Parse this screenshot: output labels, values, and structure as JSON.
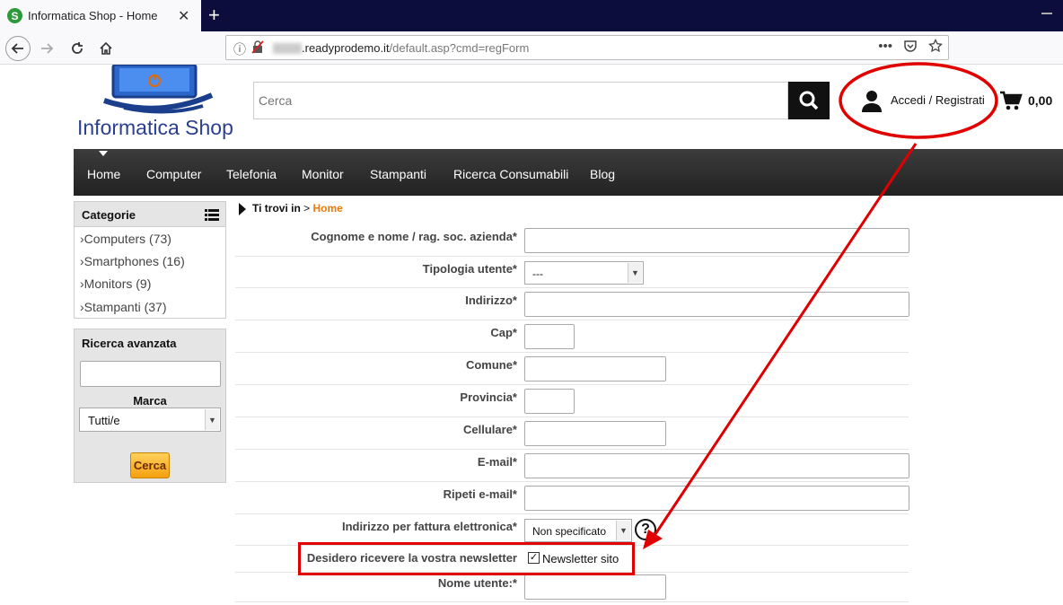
{
  "browser": {
    "tab_title": "Informatica Shop - Home",
    "tab_favicon": "S",
    "close_glyph": "✕",
    "new_tab_glyph": "+",
    "url_domain": ".readyprodemo.it",
    "url_path": "/default.asp?cmd=regForm",
    "icons": [
      "back-icon",
      "forward-icon",
      "reload-icon",
      "home-icon",
      "info-icon",
      "lock-icon",
      "more-icon",
      "pocket-icon",
      "bookmark-star-icon"
    ]
  },
  "header": {
    "logo_text": "Informatica Shop",
    "search_placeholder": "Cerca",
    "login_label": "Accedi / Registrati",
    "cart_total": "0,00"
  },
  "menu": {
    "items": [
      "Home",
      "Computer",
      "Telefonia",
      "Monitor",
      "Stampanti",
      "Ricerca Consumabili",
      "Blog"
    ]
  },
  "sidebar": {
    "categories_title": "Categorie",
    "categories": [
      "Computers (73)",
      "Smartphones (16)",
      "Monitors (9)",
      "Stampanti (37)"
    ],
    "advanced_title": "Ricerca avanzata",
    "brand_label": "Marca",
    "brand_value": "Tutti/e",
    "search_button": "Cerca"
  },
  "breadcrumb": {
    "prefix": "Ti trovi in",
    "separator": ">",
    "current": "Home"
  },
  "form": {
    "fields": [
      {
        "label": "Cognome e nome / rag. soc. azienda*"
      },
      {
        "label": "Tipologia utente*",
        "value": "---"
      },
      {
        "label": "Indirizzo*"
      },
      {
        "label": "Cap*"
      },
      {
        "label": "Comune*"
      },
      {
        "label": "Provincia*"
      },
      {
        "label": "Cellulare*"
      },
      {
        "label": "E-mail*"
      },
      {
        "label": "Ripeti e-mail*"
      },
      {
        "label": "Indirizzo per fattura elettronica*",
        "value": "Non specificato"
      },
      {
        "label": "Desidero ricevere la vostra newsletter",
        "checkbox_label": "Newsletter sito",
        "checked": true
      },
      {
        "label": "Nome utente:*"
      }
    ],
    "help_glyph": "?"
  },
  "colors": {
    "annotation": "#e00000",
    "accent_orange": "#e97b0c",
    "logo_blue": "#2a3f8f"
  }
}
